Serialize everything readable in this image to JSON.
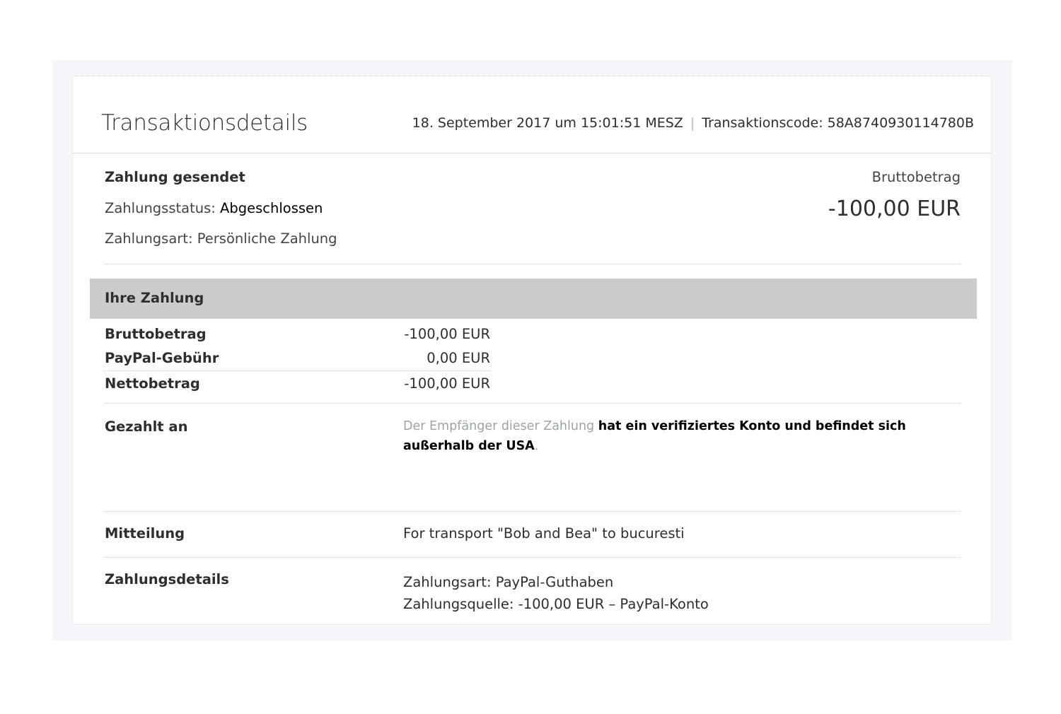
{
  "header": {
    "title": "Transaktionsdetails",
    "date": "18. September 2017 um 15:01:51 MESZ",
    "separator": "|",
    "transaction_code": "Transaktionscode: 58A8740930114780B"
  },
  "summary": {
    "title": "Zahlung gesendet",
    "status_label": "Zahlungsstatus: ",
    "status_value": "Abgeschlossen",
    "type": "Zahlungsart: Persönliche Zahlung",
    "gross_caption": "Bruttobetrag",
    "gross_amount": "-100,00 EUR"
  },
  "payment": {
    "section_title": "Ihre Zahlung",
    "rows": [
      {
        "label": "Bruttobetrag",
        "value": "-100,00 EUR"
      },
      {
        "label": "PayPal-Gebühr",
        "value": "0,00 EUR"
      },
      {
        "label": "Nettobetrag",
        "value": "-100,00 EUR"
      }
    ]
  },
  "paid_to": {
    "label": "Gezahlt an",
    "text_muted": "Der Empfänger dieser Zahlung ",
    "text_bold": "hat ein verifiziertes Konto und befindet sich außerhalb der USA",
    "text_end": "."
  },
  "message": {
    "label": "Mitteilung",
    "value": "For transport \"Bob and Bea\" to bucuresti"
  },
  "payment_details": {
    "label": "Zahlungsdetails",
    "method": "Zahlungsart: PayPal-Guthaben",
    "source": "Zahlungsquelle: -100,00 EUR – PayPal-Konto"
  }
}
